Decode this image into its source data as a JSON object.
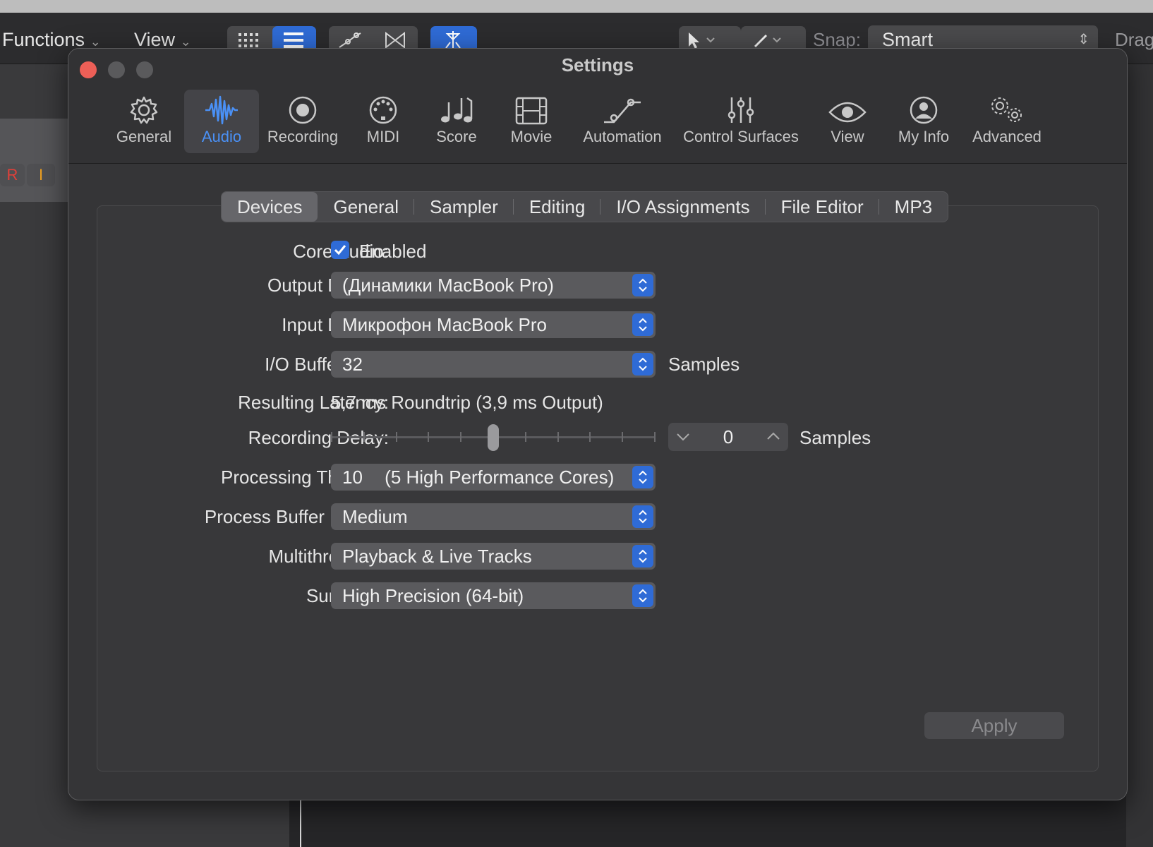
{
  "app_toolbar": {
    "functions_label": "Functions",
    "view_label": "View",
    "snap_label": "Snap:",
    "snap_value": "Smart",
    "drag_label": "Drag"
  },
  "track_buttons": {
    "record": "R",
    "input": "I"
  },
  "window": {
    "title": "Settings"
  },
  "pref_tabs": [
    {
      "label": "General",
      "icon": "gear-icon"
    },
    {
      "label": "Audio",
      "icon": "waveform-icon"
    },
    {
      "label": "Recording",
      "icon": "record-icon"
    },
    {
      "label": "MIDI",
      "icon": "midi-port-icon"
    },
    {
      "label": "Score",
      "icon": "music-notes-icon"
    },
    {
      "label": "Movie",
      "icon": "film-icon"
    },
    {
      "label": "Automation",
      "icon": "automation-curve-icon"
    },
    {
      "label": "Control Surfaces",
      "icon": "sliders-icon"
    },
    {
      "label": "View",
      "icon": "eye-icon"
    },
    {
      "label": "My Info",
      "icon": "person-icon"
    },
    {
      "label": "Advanced",
      "icon": "gears-icon"
    }
  ],
  "selected_pref_tab": "Audio",
  "sub_tabs": [
    {
      "label": "Devices"
    },
    {
      "label": "General"
    },
    {
      "label": "Sampler"
    },
    {
      "label": "Editing"
    },
    {
      "label": "I/O Assignments"
    },
    {
      "label": "File Editor"
    },
    {
      "label": "MP3"
    }
  ],
  "selected_sub_tab": "Devices",
  "devices": {
    "core_audio_label": "Core Audio:",
    "core_audio_checkbox_label": "Enabled",
    "core_audio_enabled": true,
    "output_device_label": "Output Device:",
    "output_device_value": "(Динамики MacBook Pro)",
    "input_device_label": "Input Device:",
    "input_device_value": "Микрофон MacBook Pro",
    "buffer_size_label": "I/O Buffer Size:",
    "buffer_size_value": "32",
    "buffer_size_unit": "Samples",
    "latency_label": "Resulting Latency:",
    "latency_value": "5,7 ms Roundtrip (3,9 ms Output)",
    "recording_delay_label": "Recording Delay:",
    "recording_delay_value": "0",
    "recording_delay_slider_fraction": 0.5,
    "recording_delay_unit": "Samples",
    "threads_label": "Processing Threads:",
    "threads_value": "10",
    "threads_detail": "(5 High Performance Cores)",
    "buffer_range_label": "Process Buffer Range:",
    "buffer_range_value": "Medium",
    "multithreading_label": "Multithreading:",
    "multithreading_value": "Playback & Live Tracks",
    "summing_label": "Summing:",
    "summing_value": "High Precision (64-bit)"
  },
  "apply_label": "Apply",
  "colors": {
    "accent": "#2f6bd6",
    "selected_tab_text": "#4a90f5",
    "close": "#ed5f57",
    "record": "#e0403a",
    "input": "#f0a020"
  }
}
